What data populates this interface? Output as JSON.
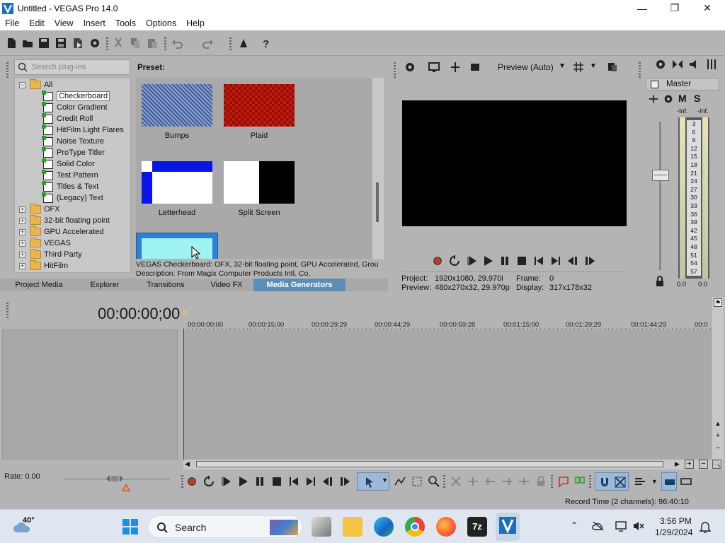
{
  "window": {
    "title": "Untitled - VEGAS Pro 14.0",
    "minimize": "—",
    "maximize": "❐",
    "close": "✕"
  },
  "menu": [
    "File",
    "Edit",
    "View",
    "Insert",
    "Tools",
    "Options",
    "Help"
  ],
  "toolbar": {
    "preview_label": "Preview (Auto)"
  },
  "search": {
    "placeholder": "Search plug-ins"
  },
  "tree": {
    "root": "All",
    "items": [
      "Checkerboard",
      "Color Gradient",
      "Credit Roll",
      "HitFilm Light Flares",
      "Noise Texture",
      "ProType Titler",
      "Solid Color",
      "Test Pattern",
      "Titles & Text",
      "(Legacy) Text"
    ],
    "selected": "Checkerboard",
    "folders": [
      "OFX",
      "32-bit floating point",
      "GPU Accelerated",
      "VEGAS",
      "Third Party",
      "HitFilm"
    ]
  },
  "preset": {
    "label": "Preset:",
    "items": [
      {
        "name": "Bumps"
      },
      {
        "name": "Plaid"
      },
      {
        "name": "Letterhead"
      },
      {
        "name": "Split Screen"
      }
    ]
  },
  "description": {
    "line1": "VEGAS Checkerboard: OFX, 32-bit floating point, GPU Accelerated, Grou",
    "line2": "Description: From Magix Computer Products Intl. Co."
  },
  "tabs": [
    {
      "label": "Project Media",
      "active": false
    },
    {
      "label": "Explorer",
      "active": false
    },
    {
      "label": "Transitions",
      "active": false
    },
    {
      "label": "Video FX",
      "active": false
    },
    {
      "label": "Media Generators",
      "active": true
    }
  ],
  "preview_info": {
    "project_label": "Project:",
    "project_value": "1920x1080, 29.970i",
    "preview_label": "Preview:",
    "preview_value": "480x270x32, 29.970p",
    "frame_label": "Frame:",
    "frame_value": "0",
    "display_label": "Display:",
    "display_value": "317x178x32"
  },
  "mixer": {
    "title": "Master",
    "m": "M",
    "s": "S",
    "inf_left": "-Inf.",
    "inf_right": "-Inf.",
    "scale": [
      "3",
      "6",
      "9",
      "12",
      "15",
      "18",
      "21",
      "24",
      "27",
      "30",
      "33",
      "36",
      "39",
      "42",
      "45",
      "48",
      "51",
      "54",
      "57"
    ],
    "val_left": "0.0",
    "val_right": "0.0"
  },
  "timeline": {
    "timecode": "00:00:00;00",
    "ruler": [
      "00:00:00;00",
      "00:00:15;00",
      "00:00:29;29",
      "00:00:44;29",
      "00:00:59;28",
      "00:01:15;00",
      "00:01:29;29",
      "00:01:44;29",
      "00:0"
    ],
    "rate": "Rate: 0.00"
  },
  "status": {
    "record_time": "Record Time (2 channels): 96:40:10"
  },
  "taskbar": {
    "weather": "40°",
    "search": "Search",
    "time": "3:56 PM",
    "date": "1/29/2024"
  },
  "colors": {
    "accent": "#5c8fb8",
    "panel": "#b4b4b4",
    "plaid": "#c81a0a",
    "blue": "#0b14e6",
    "selected_preset": "#9ff3f1"
  }
}
